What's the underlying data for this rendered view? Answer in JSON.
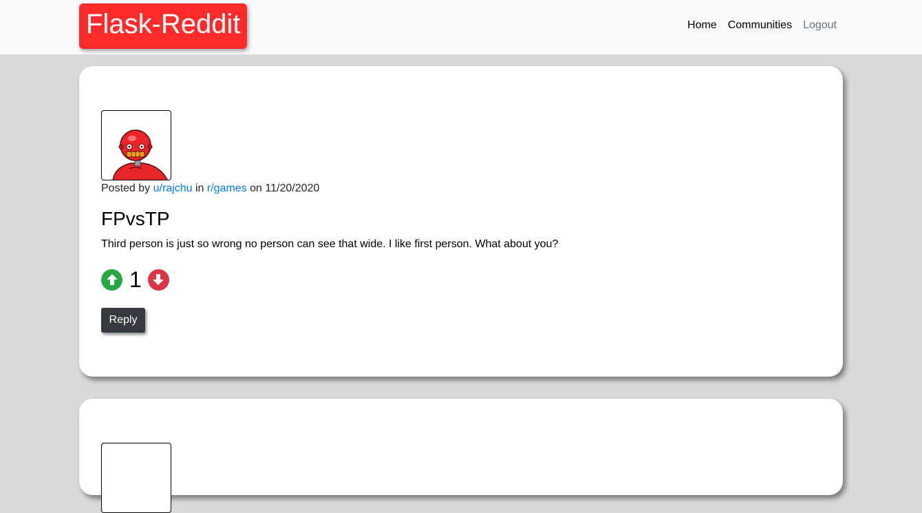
{
  "nav": {
    "brand": "Flask-Reddit",
    "links": [
      "Home",
      "Communities",
      "Logout"
    ]
  },
  "post": {
    "meta_prefix": "Posted by",
    "author": "u/rajchu",
    "meta_in": "in",
    "community": "r/games",
    "meta_on": "on",
    "date": "11/20/2020",
    "title": "FPvsTP",
    "body": "Third person is just so wrong no person can see that wide. I like first person. What about you?",
    "score": "1",
    "reply_label": "Reply"
  },
  "colors": {
    "brand": "#ff2b2b",
    "upvote": "#28a745",
    "downvote": "#dc3545",
    "link": "#007bff",
    "button_dark": "#343a40"
  },
  "icons": {
    "avatar": "red-robot-avatar",
    "upvote": "arrow-up-circle-icon",
    "downvote": "arrow-down-circle-icon"
  }
}
